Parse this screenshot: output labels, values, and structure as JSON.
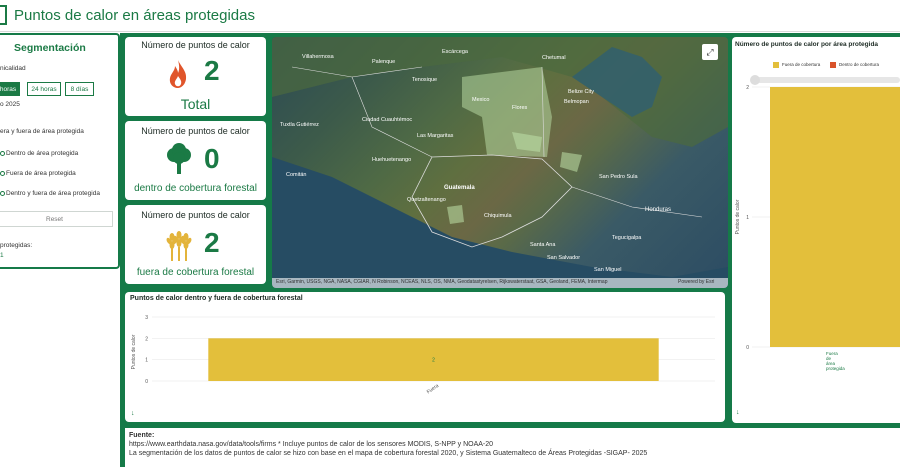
{
  "header": {
    "title": "Puntos de calor en áreas protegidas"
  },
  "sidebar": {
    "title": "Segmentación",
    "periodicity_label": "nicalidad",
    "tabs": [
      {
        "label": "horas",
        "active": true
      },
      {
        "label": "24 horas",
        "active": false
      },
      {
        "label": "8 días",
        "active": false
      }
    ],
    "date_value": "o 2025",
    "area_filter_label": "era y fuera de área protegida",
    "options": [
      "Dentro de área protegida",
      "Fuera de área protegida",
      "Dentro y fuera de área protegida"
    ],
    "reset_label": "Reset",
    "protected_label": "protegidas:",
    "protected_value": "1"
  },
  "cards": [
    {
      "title": "Número de puntos de calor",
      "value": "2",
      "subtitle": "Total",
      "icon": "fire-icon",
      "color": "#e0552b"
    },
    {
      "title": "Número de puntos de calor",
      "value": "0",
      "subtitle": "dentro de cobertura forestal",
      "icon": "tree-icon",
      "color": "#1b7a45"
    },
    {
      "title": "Número de puntos de calor",
      "value": "2",
      "subtitle": "fuera de cobertura forestal",
      "icon": "wheat-icon",
      "color": "#e3b43b"
    }
  ],
  "map": {
    "labels": [
      "Villahermosa",
      "Palenque",
      "Tenosique",
      "Belmopan",
      "Belize City",
      "Flores",
      "Mexico",
      "Chetumal",
      "Escárcega",
      "Tuxtla Gutiérrez",
      "Ciudad Cuauhtémoc",
      "Las Margaritas",
      "Guatemala",
      "Quetzaltenango",
      "Huehuetenango",
      "Chiquimula",
      "San Pedro Sula",
      "Tegucigalpa",
      "Santa Ana",
      "San Salvador",
      "San Miguel",
      "Honduras",
      "Comitán"
    ],
    "attribution": "Esri, Garmin, USGS, NGA, NASA, CGIAR, N Robinson, NCEAS, NLS, OS, NMA, Geodatastyrelsen, Rijkswaterstaat, GSA, Geoland, FEMA, Intermap",
    "powered": "Powered by Esri",
    "expand_icon": "expand-icon"
  },
  "chart_bottom": {
    "title": "Puntos de calor dentro y fuera de cobertura forestal",
    "menu_icon": "download-icon",
    "chart_data": {
      "type": "bar",
      "categories": [
        "Fuera"
      ],
      "values": [
        2
      ],
      "ylabel": "Puntos de calor",
      "ylim": [
        0,
        3
      ],
      "yticks": [
        "3",
        "2",
        "1",
        "0"
      ],
      "bar_color": "#e3bf3b"
    }
  },
  "chart_right": {
    "title": "Número de puntos de calor por área protegida",
    "legend": [
      {
        "name": "Fuera de cobertura",
        "color": "#e3bf3b"
      },
      {
        "name": "Dentro de cobertura",
        "color": "#d9532b"
      }
    ],
    "chart_data": {
      "type": "bar",
      "categories": [
        "Fuera de área protegida"
      ],
      "values": [
        2
      ],
      "ylim": [
        0,
        2
      ],
      "yticks": [
        "2",
        "1",
        "0"
      ],
      "ylabel": "Puntos de calor"
    }
  },
  "footer": {
    "source_label": "Fuente:",
    "line1": "https://www.earthdata.nasa.gov/data/tools/firms * Incluye puntos de calor de los sensores MODIS, S-NPP y NOAA-20",
    "line2": "La segmentación de los datos de puntos de calor se hizo con base en el mapa de cobertura forestal 2020, y Sistema Guatemalteco de Áreas Protegidas -SIGAP- 2025"
  }
}
